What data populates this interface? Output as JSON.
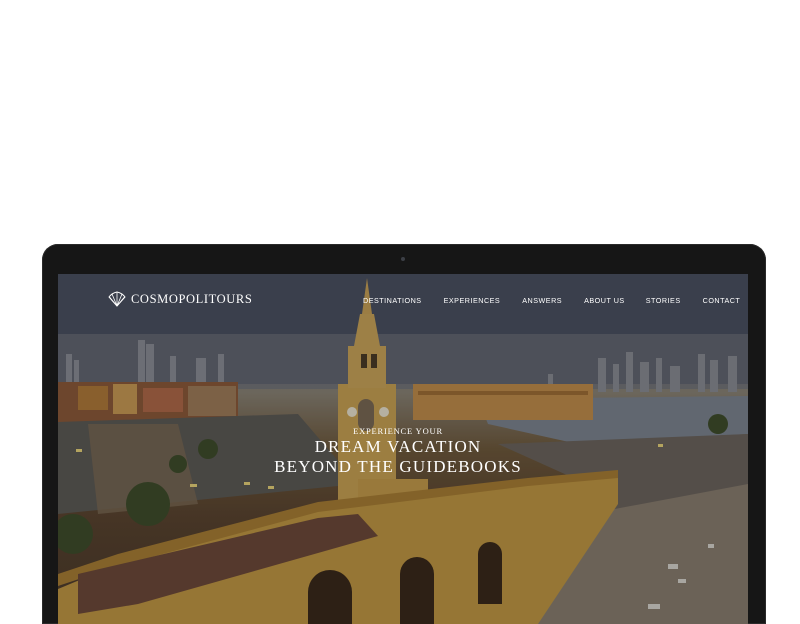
{
  "site": {
    "brand": "COSMOPOLITOURS",
    "nav": [
      {
        "label": "DESTINATIONS"
      },
      {
        "label": "EXPERIENCES"
      },
      {
        "label": "ANSWERS"
      },
      {
        "label": "ABOUT US"
      },
      {
        "label": "STORIES"
      },
      {
        "label": "CONTACT"
      }
    ],
    "hero": {
      "kicker": "EXPERIENCE YOUR",
      "line1": "DREAM VACATION",
      "line2": "BEYOND THE GUIDEBOOKS"
    }
  },
  "colors": {
    "laptop_bezel": "#161616",
    "text": "#ffffff",
    "wall": "#c9a24a"
  }
}
